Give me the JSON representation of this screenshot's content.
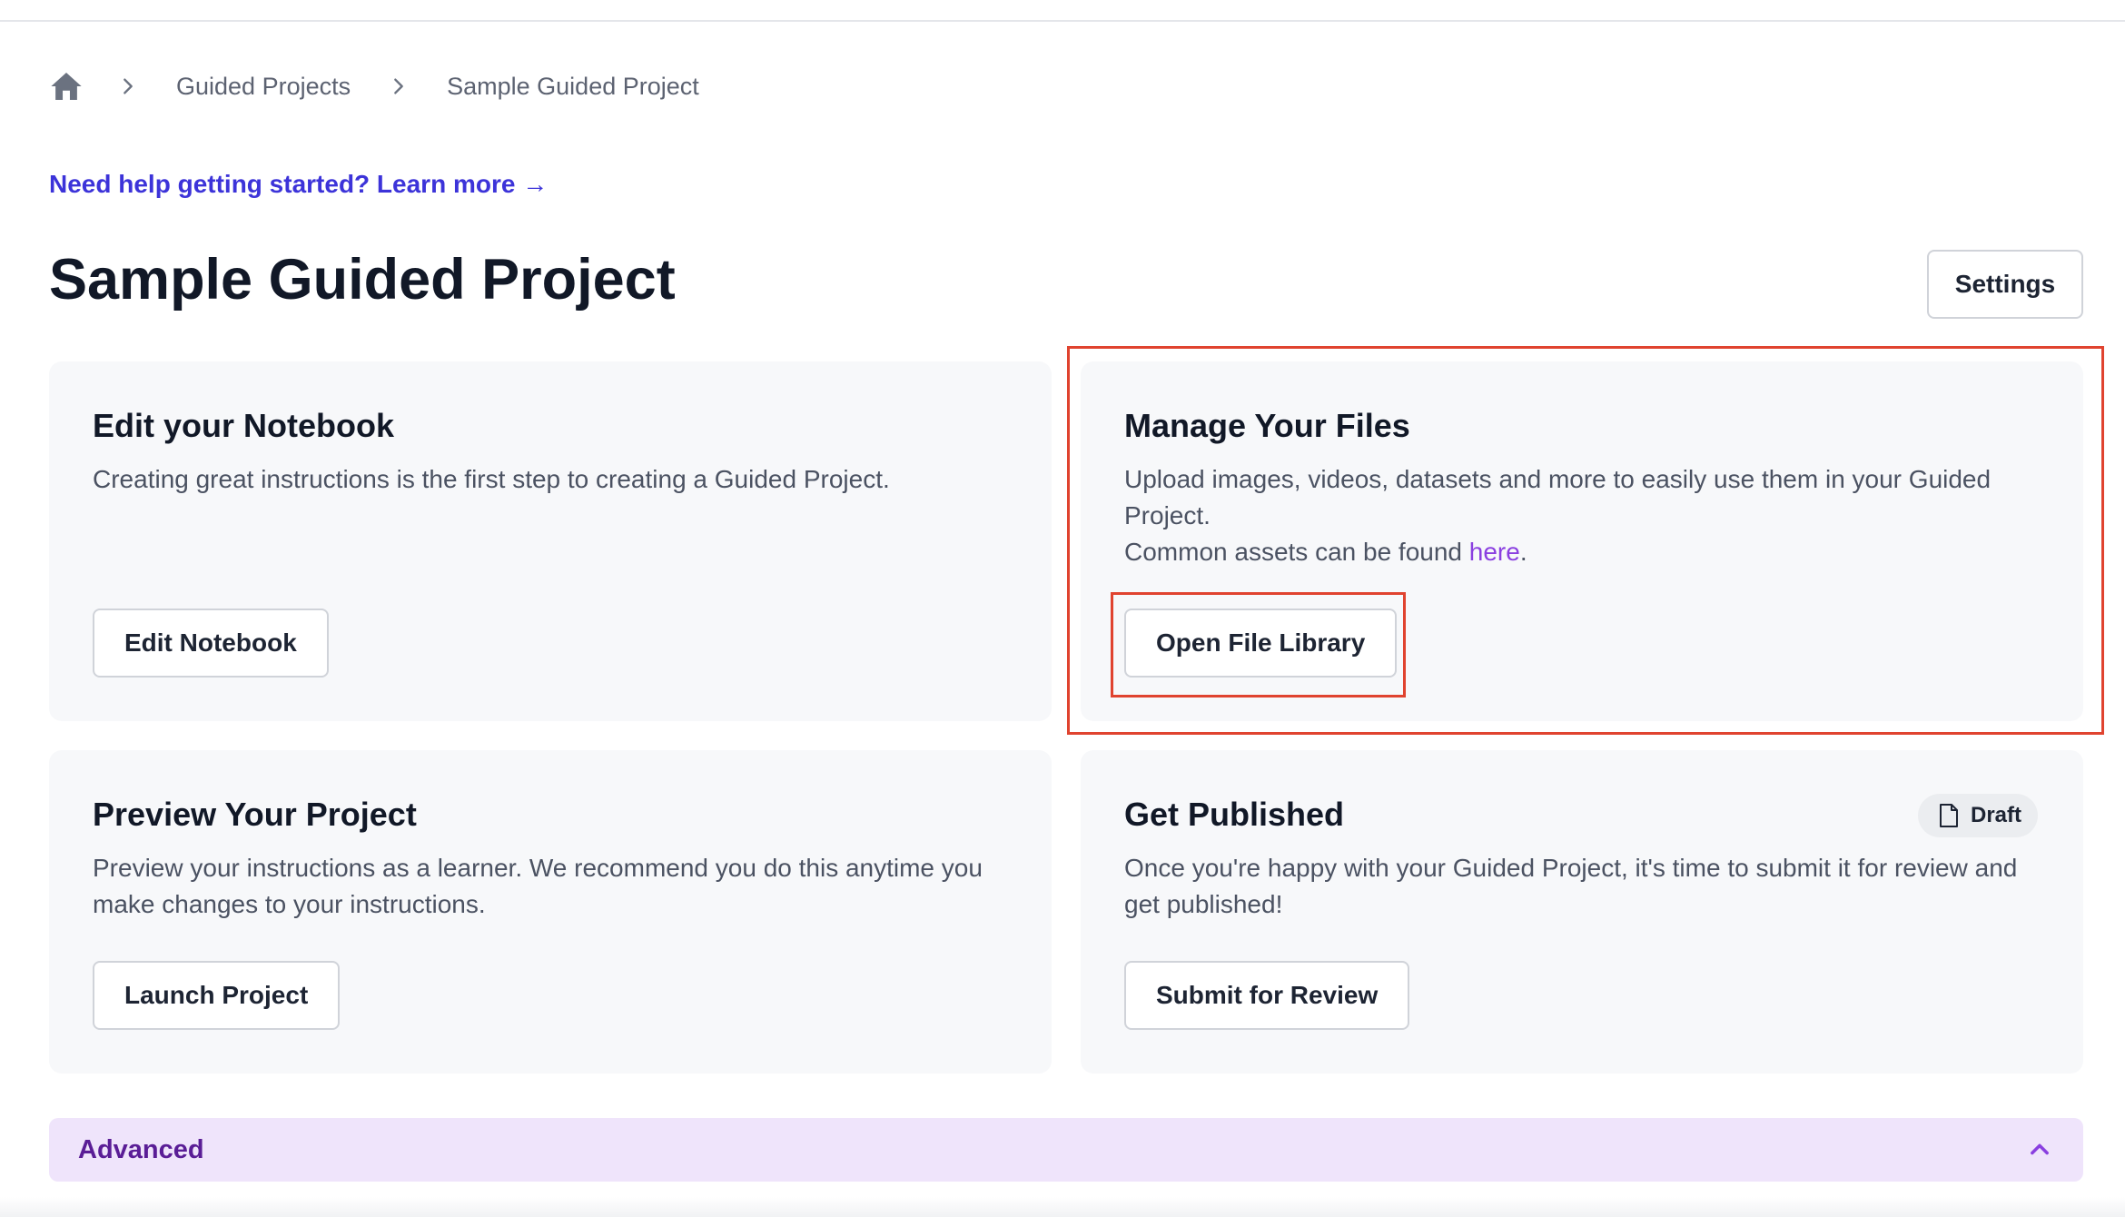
{
  "breadcrumb": {
    "home_icon": "home-icon",
    "items": [
      "Guided Projects",
      "Sample Guided Project"
    ]
  },
  "help_link": {
    "label": "Need help getting started? Learn more →"
  },
  "page": {
    "title": "Sample Guided Project",
    "settings_label": "Settings"
  },
  "cards": {
    "notebook": {
      "title": "Edit your Notebook",
      "description": "Creating great instructions is the first step to creating a Guided Project.",
      "button": "Edit Notebook"
    },
    "files": {
      "title": "Manage Your Files",
      "description_line1": "Upload images, videos, datasets and more to easily use them in your Guided Project.",
      "description_line2_prefix": "Common assets can be found ",
      "description_link": "here",
      "description_line2_suffix": ".",
      "button": "Open File Library"
    },
    "preview": {
      "title": "Preview Your Project",
      "description": "Preview your instructions as a learner. We recommend you do this anytime you make changes to your instructions.",
      "button": "Launch Project"
    },
    "publish": {
      "title": "Get Published",
      "badge": "Draft",
      "badge_icon": "document-icon",
      "description": "Once you're happy with your Guided Project, it's time to submit it for review and get published!",
      "button": "Submit for Review"
    }
  },
  "advanced": {
    "label": "Advanced",
    "icon": "chevron-up-icon"
  },
  "colors": {
    "link": "#3c33d9",
    "accent_purple": "#8a3fe0",
    "highlight": "#e0432f",
    "advanced_bg": "#efe4fb",
    "card_bg": "#f7f8fa"
  }
}
